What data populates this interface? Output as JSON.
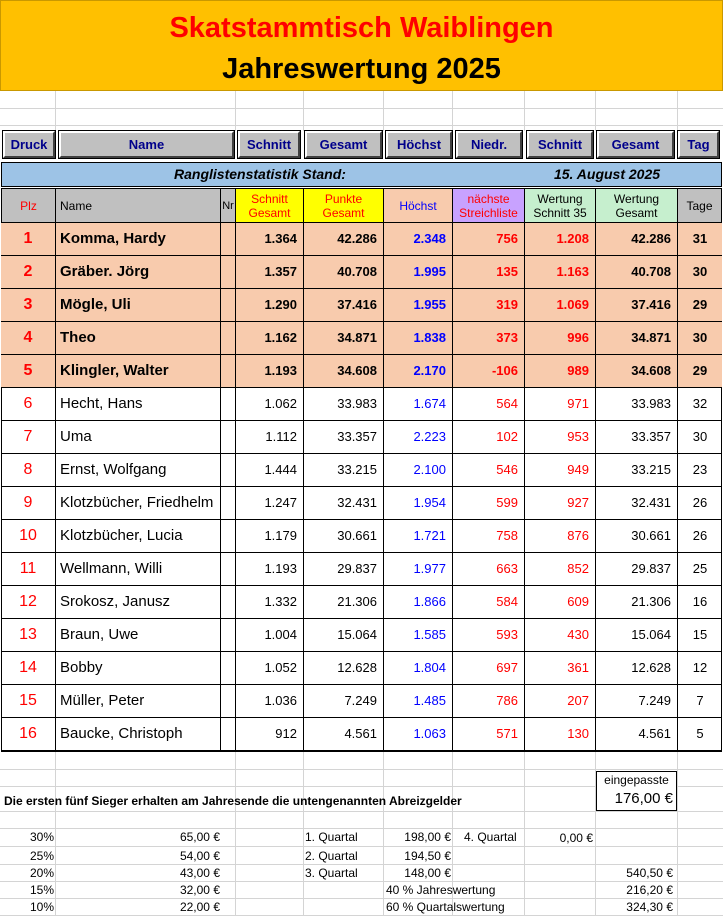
{
  "title": {
    "line1": "Skatstammtisch Waiblingen",
    "line2": "Jahreswertung 2025"
  },
  "toolbar": [
    {
      "name": "druck-button",
      "label": "Druck"
    },
    {
      "name": "name-button",
      "label": "Name"
    },
    {
      "name": "schnitt-button",
      "label": "Schnitt"
    },
    {
      "name": "gesamt-button",
      "label": "Gesamt"
    },
    {
      "name": "hoechst-button",
      "label": "Höchst"
    },
    {
      "name": "niedr-button",
      "label": "Niedr."
    },
    {
      "name": "schnitt2-button",
      "label": "Schnitt"
    },
    {
      "name": "gesamt2-button",
      "label": "Gesamt"
    },
    {
      "name": "tag-button",
      "label": "Tag"
    }
  ],
  "stand": {
    "label": "Ranglistenstatistik Stand:",
    "date": "15. August 2025"
  },
  "headers": {
    "plz": "Plz",
    "name": "Name",
    "nr": "Nr",
    "schnitt_gesamt": "Schnitt Gesamt",
    "punkte_gesamt": "Punkte Gesamt",
    "hoechst": "Höchst",
    "streichliste": "nächste Streichliste",
    "wertung_schnitt": "Wertung Schnitt 35",
    "wertung_gesamt": "Wertung Gesamt",
    "tage": "Tage"
  },
  "rows": [
    {
      "plz": "1",
      "name": "Komma, Hardy",
      "schnitt": "1.364",
      "gesamt": "42.286",
      "hoechst": "2.348",
      "niedr": "756",
      "w35": "1.208",
      "wges": "42.286",
      "tage": "31",
      "top": true
    },
    {
      "plz": "2",
      "name": "Gräber. Jörg",
      "schnitt": "1.357",
      "gesamt": "40.708",
      "hoechst": "1.995",
      "niedr": "135",
      "w35": "1.163",
      "wges": "40.708",
      "tage": "30",
      "top": true
    },
    {
      "plz": "3",
      "name": "Mögle, Uli",
      "schnitt": "1.290",
      "gesamt": "37.416",
      "hoechst": "1.955",
      "niedr": "319",
      "w35": "1.069",
      "wges": "37.416",
      "tage": "29",
      "top": true
    },
    {
      "plz": "4",
      "name": "Theo",
      "schnitt": "1.162",
      "gesamt": "34.871",
      "hoechst": "1.838",
      "niedr": "373",
      "w35": "996",
      "wges": "34.871",
      "tage": "30",
      "top": true
    },
    {
      "plz": "5",
      "name": "Klingler, Walter",
      "schnitt": "1.193",
      "gesamt": "34.608",
      "hoechst": "2.170",
      "niedr": "-106",
      "w35": "989",
      "wges": "34.608",
      "tage": "29",
      "top": true
    },
    {
      "plz": "6",
      "name": "Hecht, Hans",
      "schnitt": "1.062",
      "gesamt": "33.983",
      "hoechst": "1.674",
      "niedr": "564",
      "w35": "971",
      "wges": "33.983",
      "tage": "32",
      "top": false
    },
    {
      "plz": "7",
      "name": "Uma",
      "schnitt": "1.112",
      "gesamt": "33.357",
      "hoechst": "2.223",
      "niedr": "102",
      "w35": "953",
      "wges": "33.357",
      "tage": "30",
      "top": false
    },
    {
      "plz": "8",
      "name": "Ernst, Wolfgang",
      "schnitt": "1.444",
      "gesamt": "33.215",
      "hoechst": "2.100",
      "niedr": "546",
      "w35": "949",
      "wges": "33.215",
      "tage": "23",
      "top": false
    },
    {
      "plz": "9",
      "name": "Klotzbücher, Friedhelm",
      "schnitt": "1.247",
      "gesamt": "32.431",
      "hoechst": "1.954",
      "niedr": "599",
      "w35": "927",
      "wges": "32.431",
      "tage": "26",
      "top": false
    },
    {
      "plz": "10",
      "name": "Klotzbücher, Lucia",
      "schnitt": "1.179",
      "gesamt": "30.661",
      "hoechst": "1.721",
      "niedr": "758",
      "w35": "876",
      "wges": "30.661",
      "tage": "26",
      "top": false
    },
    {
      "plz": "11",
      "name": "Wellmann, Willi",
      "schnitt": "1.193",
      "gesamt": "29.837",
      "hoechst": "1.977",
      "niedr": "663",
      "w35": "852",
      "wges": "29.837",
      "tage": "25",
      "top": false
    },
    {
      "plz": "12",
      "name": "Srokosz, Janusz",
      "schnitt": "1.332",
      "gesamt": "21.306",
      "hoechst": "1.866",
      "niedr": "584",
      "w35": "609",
      "wges": "21.306",
      "tage": "16",
      "top": false
    },
    {
      "plz": "13",
      "name": "Braun, Uwe",
      "schnitt": "1.004",
      "gesamt": "15.064",
      "hoechst": "1.585",
      "niedr": "593",
      "w35": "430",
      "wges": "15.064",
      "tage": "15",
      "top": false
    },
    {
      "plz": "14",
      "name": "Bobby",
      "schnitt": "1.052",
      "gesamt": "12.628",
      "hoechst": "1.804",
      "niedr": "697",
      "w35": "361",
      "wges": "12.628",
      "tage": "12",
      "top": false
    },
    {
      "plz": "15",
      "name": "Müller, Peter",
      "schnitt": "1.036",
      "gesamt": "7.249",
      "hoechst": "1.485",
      "niedr": "786",
      "w35": "207",
      "wges": "7.249",
      "tage": "7",
      "top": false
    },
    {
      "plz": "16",
      "name": "Baucke, Christoph",
      "schnitt": "912",
      "gesamt": "4.561",
      "hoechst": "1.063",
      "niedr": "571",
      "w35": "130",
      "wges": "4.561",
      "tage": "5",
      "top": false
    }
  ],
  "footer": {
    "eingepasste_label": "eingepasste",
    "eingepasste_value": "176,00 €",
    "note": "Die ersten fünf Sieger erhalten am Jahresende die untengenannten Abreizgelder",
    "prizes": [
      {
        "pct": "30%",
        "amount": "65,00 €"
      },
      {
        "pct": "25%",
        "amount": "54,00 €"
      },
      {
        "pct": "20%",
        "amount": "43,00 €"
      },
      {
        "pct": "15%",
        "amount": "32,00 €"
      },
      {
        "pct": "10%",
        "amount": "22,00 €"
      }
    ],
    "quartals": [
      {
        "label": "1. Quartal",
        "amount": "198,00 €"
      },
      {
        "label": "2. Quartal",
        "amount": "194,50 €"
      },
      {
        "label": "3. Quartal",
        "amount": "148,00 €"
      }
    ],
    "q4_label": "4. Quartal",
    "q4_amount": "0,00 €",
    "total": "540,50 €",
    "jahres_label": "40 % Jahreswertung",
    "jahres_amount": "216,20 €",
    "quartals_label": "60 % Quartalswertung",
    "quartals_amount": "324,30 €"
  }
}
